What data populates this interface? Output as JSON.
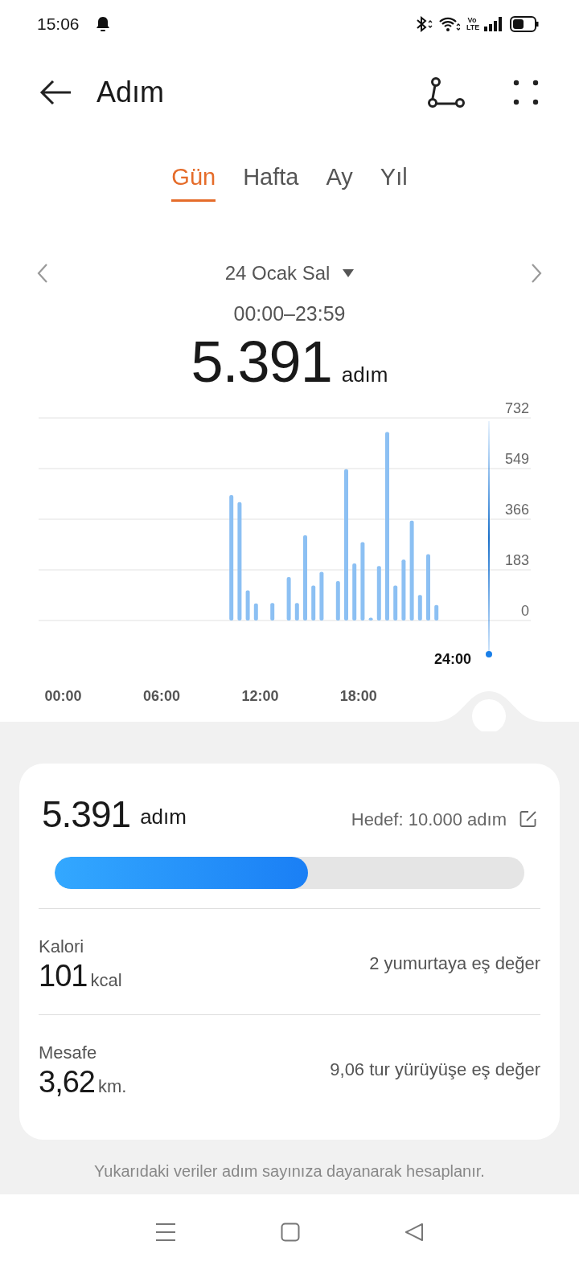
{
  "status_bar": {
    "time": "15:06",
    "network": [
      "Vo",
      "LTE"
    ]
  },
  "header": {
    "title": "Adım"
  },
  "tabs": [
    {
      "label": "Gün",
      "selected": true
    },
    {
      "label": "Hafta",
      "selected": false
    },
    {
      "label": "Ay",
      "selected": false
    },
    {
      "label": "Yıl",
      "selected": false
    }
  ],
  "date": {
    "label": "24 Ocak Sal",
    "range": "00:00–23:59"
  },
  "total": {
    "value": "5.391",
    "unit": "adım"
  },
  "chart": {
    "cursor_label": "24:00",
    "chart_data": {
      "type": "bar",
      "x": [
        10.25,
        10.75,
        11.25,
        11.75,
        12.75,
        13.75,
        14.25,
        14.75,
        15.25,
        15.75,
        16.75,
        17.25,
        17.75,
        18.25,
        18.75,
        19.25,
        19.75,
        20.25,
        20.75,
        21.25,
        21.75,
        22.25,
        22.75
      ],
      "series": [
        {
          "color": "#8cc0f3",
          "values": [
            453,
            428,
            109,
            62,
            63,
            157,
            63,
            308,
            126,
            176,
            142,
            547,
            206,
            283,
            10,
            197,
            681,
            126,
            220,
            361,
            92,
            240,
            56
          ]
        }
      ],
      "xlim": [
        -1.5,
        28.5
      ],
      "ylim": [
        0,
        732
      ],
      "grid": true,
      "xticks": [
        {
          "value": 0,
          "label": "00:00"
        },
        {
          "value": 6,
          "label": "06:00"
        },
        {
          "value": 12,
          "label": "12:00"
        },
        {
          "value": 18,
          "label": "18:00"
        }
      ],
      "yticks": [
        0,
        183,
        366,
        549,
        732
      ]
    }
  },
  "summary": {
    "steps": "5.391",
    "unit": "adım",
    "goal": "Hedef: 10.000 adım",
    "level": 0.54,
    "stats": [
      {
        "label": "Kalori",
        "value": "101",
        "unit": "kcal",
        "note": "2 yumurtaya eş değer"
      },
      {
        "label": "Mesafe",
        "value": "3,62",
        "unit": "km.",
        "note": "9,06 tur yürüyüşe eş değer"
      }
    ]
  },
  "footnote": "Yukarıdaki veriler adım sayınıza dayanarak hesaplanır."
}
